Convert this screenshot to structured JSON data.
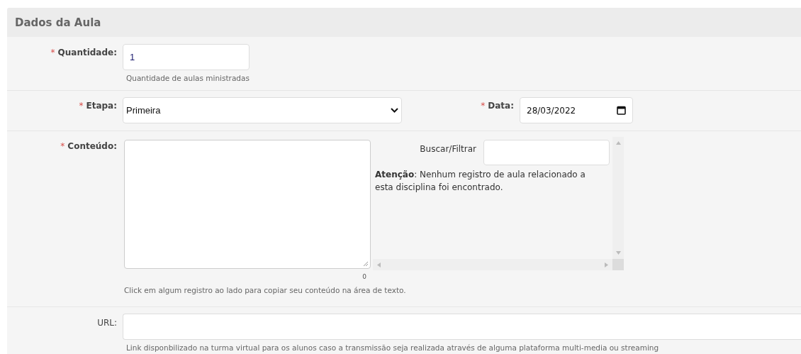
{
  "section": {
    "title": "Dados da Aula"
  },
  "quantidade": {
    "marker": "*",
    "label": "Quantidade:",
    "value": "1",
    "hint": "Quantidade de aulas ministradas"
  },
  "etapa": {
    "marker": "*",
    "label": "Etapa:",
    "value": "Primeira"
  },
  "data": {
    "marker": "*",
    "label": "Data:",
    "value": "28/03/2022"
  },
  "conteudo": {
    "marker": "*",
    "label": "Conteúdo:",
    "counter": "0",
    "hint": "Click em algum registro ao lado para copiar seu conteúdo na área de texto.",
    "search_label": "Buscar/Filtrar",
    "notice": "**Atenção**: Nenhum registro de aula relacionado a esta disciplina foi encontrado."
  },
  "url": {
    "label": "URL:",
    "hint": "Link disponbilizado na turma virtual para os alunos caso a transmissão seja realizada através de alguma plataforma multi-media ou streaming"
  }
}
